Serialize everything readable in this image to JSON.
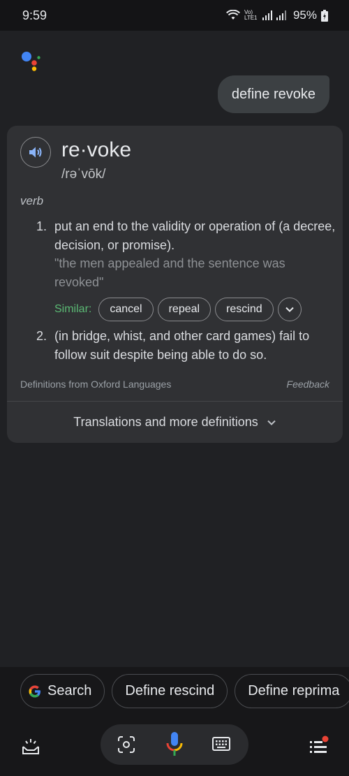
{
  "status_bar": {
    "time": "9:59",
    "network_label": "Vo) LTE1",
    "battery": "95%"
  },
  "conversation": {
    "query": "define revoke"
  },
  "definition_card": {
    "word": "re·voke",
    "phonetic": "/rəˈvōk/",
    "part_of_speech": "verb",
    "definitions": [
      {
        "number": "1.",
        "text": "put an end to the validity or operation of (a decree, decision, or promise).",
        "example": "\"the men appealed and the sentence was revoked\""
      },
      {
        "number": "2.",
        "text": "(in bridge, whist, and other card games) fail to follow suit despite being able to do so."
      }
    ],
    "similar_label": "Similar:",
    "similar_words": [
      "cancel",
      "repeal",
      "rescind"
    ],
    "source": "Definitions from Oxford Languages",
    "feedback": "Feedback",
    "more_label": "Translations and more definitions"
  },
  "suggestions": [
    "Search",
    "Define rescind",
    "Define reprima"
  ],
  "colors": {
    "background": "#202124",
    "card": "#303134",
    "speaker_blue": "#8ab4f8",
    "similar_green": "#5bb974",
    "notification_red": "#ea4335"
  },
  "icons": {
    "status": [
      "wifi-icon",
      "signal-icon",
      "battery-icon"
    ],
    "bottom_bar": [
      "snapshot-icon",
      "lens-icon",
      "mic-icon",
      "keyboard-icon",
      "menu-icon"
    ]
  }
}
